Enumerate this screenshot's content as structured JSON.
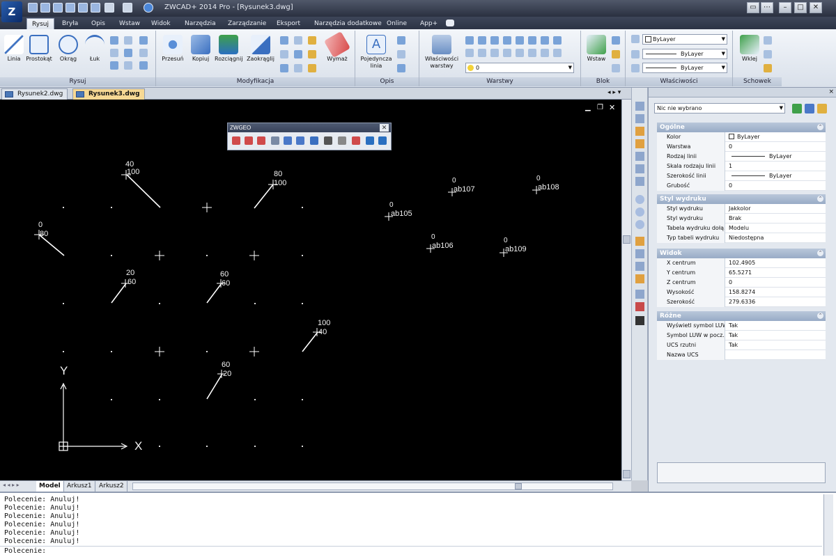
{
  "app": {
    "title": "ZWCAD+ 2014 Pro - [Rysunek3.dwg]",
    "logo_text": "Z"
  },
  "ribbon_tabs": [
    "Rysuj",
    "Bryła",
    "Opis",
    "Wstaw",
    "Widok",
    "Narzędzia",
    "Zarządzanie",
    "Eksport",
    "Narzędzia dodatkowe",
    "Online",
    "App+"
  ],
  "ribbon": {
    "rysuj": {
      "title": "Rysuj",
      "buttons": [
        "Linia",
        "Prostokąt",
        "Okrąg",
        "Łuk"
      ]
    },
    "modyfikacja": {
      "title": "Modyfikacja",
      "buttons": [
        "Przesuń",
        "Kopiuj",
        "Rozciągnij",
        "Zaokrąglij",
        "Wymaż"
      ]
    },
    "opis": {
      "title": "Opis",
      "buttons": [
        "Pojedyncza\nlinia"
      ]
    },
    "warstwy": {
      "title": "Warstwy",
      "buttons": [
        "Właściwości\nwarstwy"
      ],
      "layer_value": "0"
    },
    "blok": {
      "title": "Blok",
      "buttons": [
        "Wstaw"
      ]
    },
    "wlasciwosci": {
      "title": "Właściwości",
      "color": "ByLayer",
      "linetype": "ByLayer",
      "lineweight": "ByLayer"
    },
    "schowek": {
      "title": "Schowek",
      "buttons": [
        "Wklej"
      ]
    }
  },
  "doc_tabs": [
    {
      "label": "Rysunek2.dwg",
      "active": false
    },
    {
      "label": "Rysunek3.dwg",
      "active": true
    }
  ],
  "floating_toolbar": {
    "title": "ZWGEO"
  },
  "canvas_labels": [
    {
      "text": "40"
    },
    {
      "text": "100"
    },
    {
      "text": "80"
    },
    {
      "text": "100"
    },
    {
      "text": "0"
    },
    {
      "text": "80"
    },
    {
      "text": "20"
    },
    {
      "text": "60"
    },
    {
      "text": "60"
    },
    {
      "text": "60"
    },
    {
      "text": "100"
    },
    {
      "text": "40"
    },
    {
      "text": "60"
    },
    {
      "text": "20"
    },
    {
      "text": "0"
    },
    {
      "text": "ab105"
    },
    {
      "text": "0"
    },
    {
      "text": "ab106"
    },
    {
      "text": "0"
    },
    {
      "text": "ab107"
    },
    {
      "text": "0"
    },
    {
      "text": "ab108"
    },
    {
      "text": "0"
    },
    {
      "text": "ab109"
    }
  ],
  "ucs": {
    "x": "X",
    "y": "Y"
  },
  "layout_tabs": [
    "Model",
    "Arkusz1",
    "Arkusz2"
  ],
  "properties": {
    "selection": "Nic nie wybrano",
    "sections": [
      {
        "title": "Ogólne",
        "rows": [
          {
            "k": "Kolor",
            "v": "ByLayer"
          },
          {
            "k": "Warstwa",
            "v": "0"
          },
          {
            "k": "Rodzaj linii",
            "v": "ByLayer"
          },
          {
            "k": "Skala rodzaju linii",
            "v": "1"
          },
          {
            "k": "Szerokość linii",
            "v": "ByLayer"
          },
          {
            "k": "Grubość",
            "v": "0"
          }
        ]
      },
      {
        "title": "Styl wydruku",
        "rows": [
          {
            "k": "Styl wydruku",
            "v": "Jakkolor"
          },
          {
            "k": "Styl wydruku",
            "v": "Brak"
          },
          {
            "k": "Tabela wydruku dołą...",
            "v": "Modelu"
          },
          {
            "k": "Typ tabeli wydruku",
            "v": "Niedostępna"
          }
        ]
      },
      {
        "title": "Widok",
        "rows": [
          {
            "k": "X centrum",
            "v": "102.4905"
          },
          {
            "k": "Y centrum",
            "v": "65.5271"
          },
          {
            "k": "Z centrum",
            "v": "0"
          },
          {
            "k": "Wysokość",
            "v": "158.8274"
          },
          {
            "k": "Szerokość",
            "v": "279.6336"
          }
        ]
      },
      {
        "title": "Różne",
        "rows": [
          {
            "k": "Wyświetl symbol LUW",
            "v": "Tak"
          },
          {
            "k": "Symbol LUW w pocz...",
            "v": "Tak"
          },
          {
            "k": "UCS rzutni",
            "v": "Tak"
          },
          {
            "k": "Nazwa UCS",
            "v": ""
          }
        ]
      }
    ]
  },
  "command": {
    "history": [
      "Polecenie: Anuluj!",
      "Polecenie: Anuluj!",
      "Polecenie: Anuluj!",
      "Polecenie: Anuluj!",
      "Polecenie: Anuluj!",
      "Polecenie: Anuluj!"
    ],
    "prompt": "Polecenie:"
  },
  "colors": {
    "canvas_bg": "#000000",
    "active_doc_tab": "#f6d894",
    "ribbon_accent": "#2a5fb0"
  }
}
